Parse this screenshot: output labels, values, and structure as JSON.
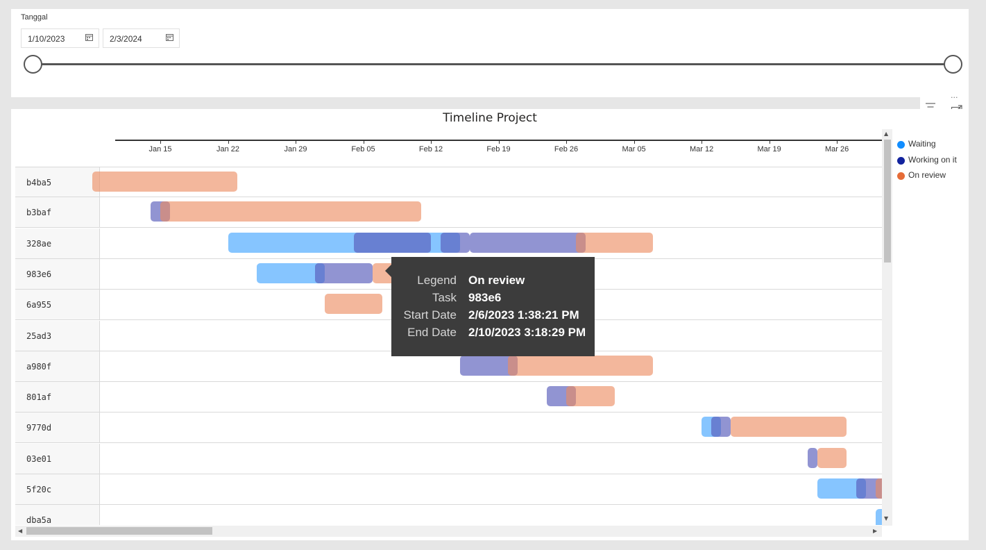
{
  "slicer": {
    "title": "Tanggal",
    "start_date": "1/10/2023",
    "end_date": "2/3/2024",
    "range_fraction": [
      0,
      1
    ]
  },
  "chart": {
    "title": "Timeline Project",
    "ticks": [
      "Jan 15",
      "Jan 22",
      "Jan 29",
      "Feb 05",
      "Feb 12",
      "Feb 19",
      "Feb 26",
      "Mar 05",
      "Mar 12",
      "Mar 19",
      "Mar 26"
    ],
    "rows": [
      {
        "task": "b4ba5",
        "segments": [
          {
            "status": "review",
            "start": "2023-01-08",
            "end": "2023-01-23"
          }
        ]
      },
      {
        "task": "b3baf",
        "segments": [
          {
            "status": "working",
            "start": "2023-01-14",
            "end": "2023-01-16"
          },
          {
            "status": "review",
            "start": "2023-01-15",
            "end": "2023-02-11"
          }
        ]
      },
      {
        "task": "328ae",
        "segments": [
          {
            "status": "waiting",
            "start": "2023-01-22",
            "end": "2023-02-15"
          },
          {
            "status": "working",
            "start": "2023-02-04",
            "end": "2023-02-12"
          },
          {
            "status": "working",
            "start": "2023-02-13",
            "end": "2023-02-16"
          },
          {
            "status": "working",
            "start": "2023-02-16",
            "end": "2023-02-28"
          },
          {
            "status": "review",
            "start": "2023-02-27",
            "end": "2023-03-07"
          }
        ]
      },
      {
        "task": "983e6",
        "segments": [
          {
            "status": "waiting",
            "start": "2023-01-25",
            "end": "2023-02-01"
          },
          {
            "status": "working",
            "start": "2023-01-31",
            "end": "2023-02-06"
          },
          {
            "status": "review",
            "start": "2023-02-06",
            "end": "2023-02-10"
          }
        ]
      },
      {
        "task": "6a955",
        "segments": [
          {
            "status": "review",
            "start": "2023-02-01",
            "end": "2023-02-07"
          }
        ]
      },
      {
        "task": "25ad3",
        "segments": []
      },
      {
        "task": "a980f",
        "segments": [
          {
            "status": "working",
            "start": "2023-02-15",
            "end": "2023-02-21"
          },
          {
            "status": "review",
            "start": "2023-02-20",
            "end": "2023-03-07"
          }
        ]
      },
      {
        "task": "801af",
        "segments": [
          {
            "status": "working",
            "start": "2023-02-24",
            "end": "2023-02-27"
          },
          {
            "status": "review",
            "start": "2023-02-26",
            "end": "2023-03-03"
          }
        ]
      },
      {
        "task": "9770d",
        "segments": [
          {
            "status": "waiting",
            "start": "2023-03-12",
            "end": "2023-03-14"
          },
          {
            "status": "working",
            "start": "2023-03-13",
            "end": "2023-03-15"
          },
          {
            "status": "review",
            "start": "2023-03-15",
            "end": "2023-03-27"
          }
        ]
      },
      {
        "task": "03e01",
        "segments": [
          {
            "status": "working",
            "start": "2023-03-23",
            "end": "2023-03-24"
          },
          {
            "status": "review",
            "start": "2023-03-24",
            "end": "2023-03-27"
          }
        ]
      },
      {
        "task": "5f20c",
        "segments": [
          {
            "status": "waiting",
            "start": "2023-03-24",
            "end": "2023-03-29"
          },
          {
            "status": "working",
            "start": "2023-03-28",
            "end": "2023-03-31"
          },
          {
            "status": "review",
            "start": "2023-03-30",
            "end": "2023-04-01"
          }
        ]
      },
      {
        "task": "dba5a",
        "segments": [
          {
            "status": "waiting",
            "start": "2023-03-30",
            "end": "2023-04-02"
          }
        ]
      }
    ]
  },
  "legend": [
    {
      "label": "Waiting",
      "color": "#118DFF"
    },
    {
      "label": "Working on it",
      "color": "#12239E"
    },
    {
      "label": "On review",
      "color": "#E66C37"
    }
  ],
  "tooltip": {
    "rows": [
      {
        "key": "Legend",
        "value": "On review"
      },
      {
        "key": "Task",
        "value": "983e6"
      },
      {
        "key": "Start Date",
        "value": "2/6/2023 1:38:21 PM"
      },
      {
        "key": "End Date",
        "value": "2/10/2023 3:18:29 PM"
      }
    ]
  },
  "icons": [
    "calendar-icon",
    "filter-icon",
    "focus-mode-icon",
    "more-options-icon"
  ]
}
